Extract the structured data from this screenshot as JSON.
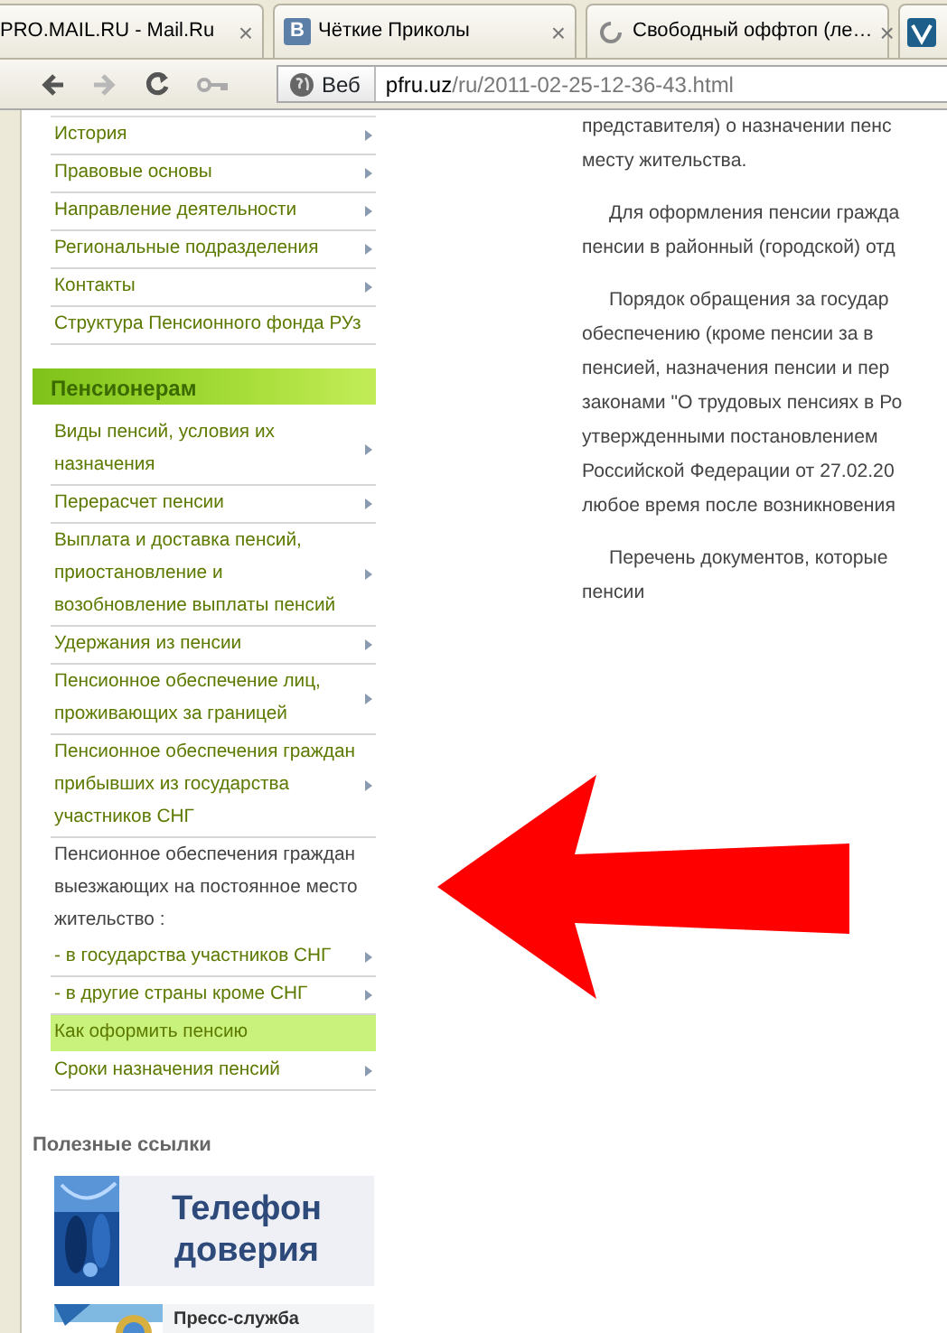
{
  "tabs": [
    {
      "kind": "plain",
      "title": "PRO.MAIL.RU - Mail.Ru",
      "close": "×"
    },
    {
      "kind": "letter",
      "title": "Чёткие Приколы",
      "icon_text": "В",
      "close": "×"
    },
    {
      "kind": "loading",
      "title": "Свободный оффтоп (ле…",
      "close": "×"
    },
    {
      "kind": "logo"
    }
  ],
  "toolbar": {
    "back_disabled": false,
    "forward_disabled": true,
    "search_label": "Веб",
    "url_host": "pfru.uz",
    "url_path": "/ru/2011-02-25-12-36-43.html"
  },
  "sidebar": {
    "menu": [
      {
        "kind": "link",
        "label": "История",
        "arrow": true,
        "selected": false
      },
      {
        "kind": "link",
        "label": "Правовые основы",
        "arrow": true,
        "selected": false
      },
      {
        "kind": "link",
        "label": "Направление деятельности",
        "arrow": true,
        "selected": false
      },
      {
        "kind": "link",
        "label": "Региональные подразделения",
        "arrow": true,
        "selected": false
      },
      {
        "kind": "link",
        "label": "Контакты",
        "arrow": true,
        "selected": false
      },
      {
        "kind": "link",
        "label": "Структура Пенсионного фонда РУз",
        "arrow": false,
        "selected": false
      },
      {
        "kind": "header",
        "label": "Пенсионерам"
      },
      {
        "kind": "link",
        "label": "Виды пенсий, условия их назначения",
        "arrow": true,
        "selected": false
      },
      {
        "kind": "link",
        "label": "Перерасчет пенсии",
        "arrow": true,
        "selected": false
      },
      {
        "kind": "link",
        "label": "Выплата и доставка пенсий, приостановление и возобновление выплаты пенсий",
        "arrow": true,
        "selected": false
      },
      {
        "kind": "link",
        "label": "Удержания из пенсии",
        "arrow": true,
        "selected": false
      },
      {
        "kind": "link",
        "label": "Пенсионное обеспечение лиц, проживающих за границей",
        "arrow": true,
        "selected": false
      },
      {
        "kind": "link",
        "label": "Пенсионное обеспечения граждан прибывших из государства участников СНГ",
        "arrow": true,
        "selected": false
      },
      {
        "kind": "note",
        "label": "Пенсионное обеспечения граждан выезжающих на постоянное место жительство :"
      },
      {
        "kind": "link",
        "label": "- в государства участников СНГ",
        "arrow": true,
        "selected": false
      },
      {
        "kind": "link",
        "label": "- в другие страны кроме СНГ",
        "arrow": true,
        "selected": false
      },
      {
        "kind": "link",
        "label": "Как оформить пенсию",
        "arrow": false,
        "selected": true
      },
      {
        "kind": "link",
        "label": "Сроки назначения пенсий",
        "arrow": true,
        "selected": false
      }
    ],
    "links_title": "Полезные ссылки",
    "banners": [
      {
        "kind": "phone",
        "lines": [
          "Телефон",
          "доверия"
        ]
      },
      {
        "kind": "press",
        "lines": [
          "Пресс-служба"
        ]
      }
    ]
  },
  "article": [
    {
      "lines": [
        "представителя) о назначении пенс",
        "месту жительства."
      ]
    },
    {
      "lines": [
        "Для оформления пенсии гражда",
        "пенсии в районный (городской) отд"
      ]
    },
    {
      "lines": [
        "Порядок обращения за государ",
        "обеспечению (кроме пенсии за в",
        "пенсией, назначения пенсии и пер",
        "законами \"О трудовых пенсиях в Ро",
        "утвержденными постановлением",
        "Российской Федерации от 27.02.20",
        "любое время после возникновения"
      ]
    },
    {
      "lines": [
        "Перечень документов, которые",
        "пенсии"
      ]
    }
  ]
}
